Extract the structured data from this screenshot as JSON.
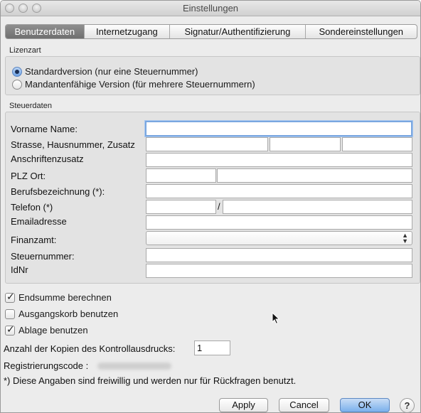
{
  "window": {
    "title": "Einstellungen"
  },
  "tabs": [
    "Benutzerdaten",
    "Internetzugang",
    "Signatur/Authentifizierung",
    "Sondereinstellungen"
  ],
  "lizenzart": {
    "label": "Lizenzart",
    "options": [
      {
        "label": "Standardversion (nur eine Steuernummer)",
        "selected": true
      },
      {
        "label": "Mandantenfähige Version (für mehrere Steuernummern)",
        "selected": false
      }
    ]
  },
  "steuerdaten": {
    "label": "Steuerdaten",
    "fields": {
      "name": "Vorname Name:",
      "strasse": "Strasse, Hausnummer, Zusatz",
      "anschriftenzusatz": "Anschriftenzusatz",
      "plz_ort": "PLZ Ort:",
      "beruf": "Berufsbezeichnung (*):",
      "telefon": "Telefon (*)",
      "email": "Emailadresse",
      "finanzamt": "Finanzamt:",
      "steuernummer": "Steuernummer:",
      "idnr": "IdNr"
    },
    "telefon_separator": "/"
  },
  "options": [
    {
      "label": "Endsumme berechnen",
      "checked": true
    },
    {
      "label": "Ausgangskorb benutzen",
      "checked": false
    },
    {
      "label": "Ablage benutzen",
      "checked": true
    }
  ],
  "kopien": {
    "label": "Anzahl der Kopien des Kontrollausdrucks:",
    "value": "1"
  },
  "registrierungscode_label": "Registrierungscode :",
  "footnote": "*) Diese Angaben sind freiwillig und werden nur für Rückfragen benutzt.",
  "buttons": {
    "apply": "Apply",
    "cancel": "Cancel",
    "ok": "OK",
    "help": "?"
  }
}
